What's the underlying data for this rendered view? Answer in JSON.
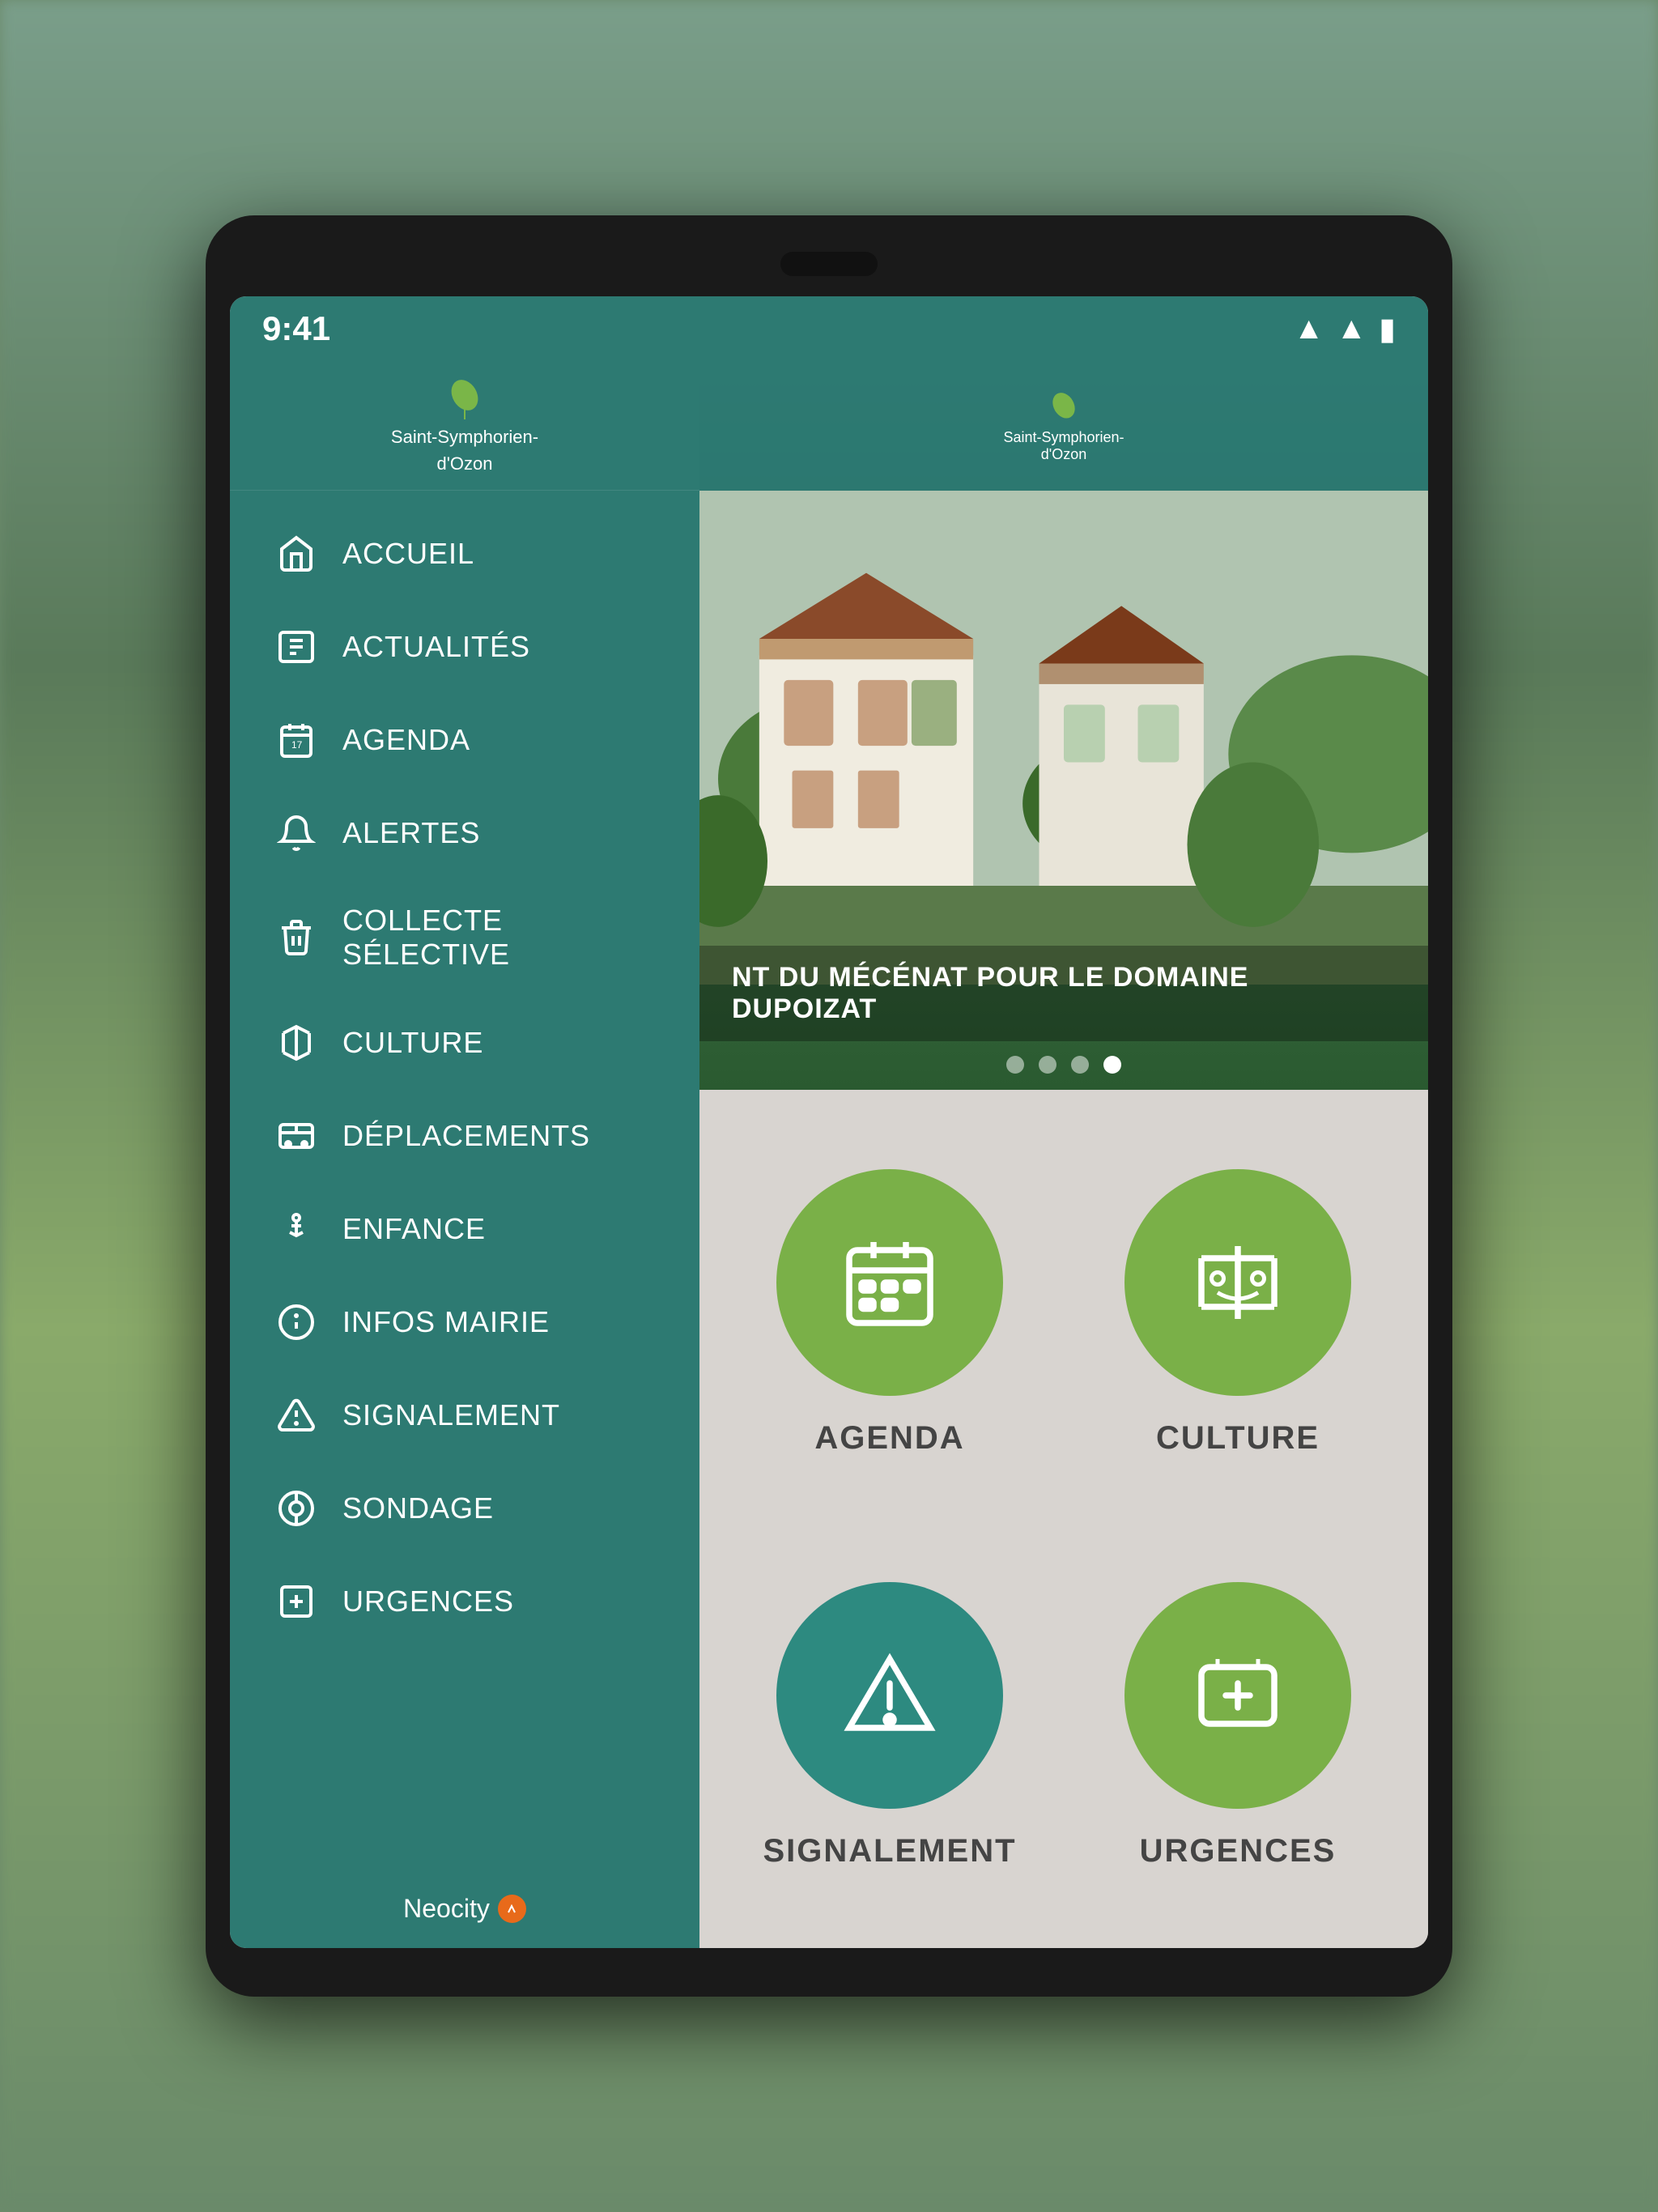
{
  "device": {
    "status_bar": {
      "time": "9:41",
      "wifi": "▲",
      "signal": "▲",
      "battery": "▐"
    }
  },
  "sidebar": {
    "logo": {
      "line1": "Saint-Symphorien-",
      "line2": "d'Ozon"
    },
    "nav_items": [
      {
        "id": "accueil",
        "label": "ACCUEIL",
        "icon": "home"
      },
      {
        "id": "actualites",
        "label": "ACTUALITÉS",
        "icon": "newspaper"
      },
      {
        "id": "agenda",
        "label": "AGENDA",
        "icon": "calendar"
      },
      {
        "id": "alertes",
        "label": "ALERTES",
        "icon": "bell"
      },
      {
        "id": "collecte",
        "label": "COLLECTE SÉLECTIVE",
        "icon": "trash"
      },
      {
        "id": "culture",
        "label": "CULTURE",
        "icon": "culture"
      },
      {
        "id": "deplacements",
        "label": "DÉPLACEMENTS",
        "icon": "bus"
      },
      {
        "id": "enfance",
        "label": "ENFANCE",
        "icon": "child"
      },
      {
        "id": "infos_mairie",
        "label": "INFOS MAIRIE",
        "icon": "info"
      },
      {
        "id": "signalement",
        "label": "SIGNALEMENT",
        "icon": "warning"
      },
      {
        "id": "sondage",
        "label": "SONDAGE",
        "icon": "poll"
      },
      {
        "id": "urgences",
        "label": "URGENCES",
        "icon": "medical"
      }
    ],
    "footer": {
      "brand": "Neocity"
    }
  },
  "hero": {
    "caption": "NT DU MÉCÉNAT POUR LE DOMAINE DUPOIZAT",
    "dots": [
      {
        "active": false
      },
      {
        "active": false
      },
      {
        "active": false
      },
      {
        "active": true
      }
    ]
  },
  "grid": {
    "items": [
      {
        "id": "agenda",
        "label": "AGENDA",
        "icon": "calendar",
        "color": "green-olive"
      },
      {
        "id": "culture",
        "label": "CULTURE",
        "icon": "culture",
        "color": "green-olive"
      },
      {
        "id": "signalement",
        "label": "SIGNALEMENT",
        "icon": "warning",
        "color": "teal"
      },
      {
        "id": "urgences",
        "label": "URGENCES",
        "icon": "medical",
        "color": "green-olive"
      }
    ]
  }
}
